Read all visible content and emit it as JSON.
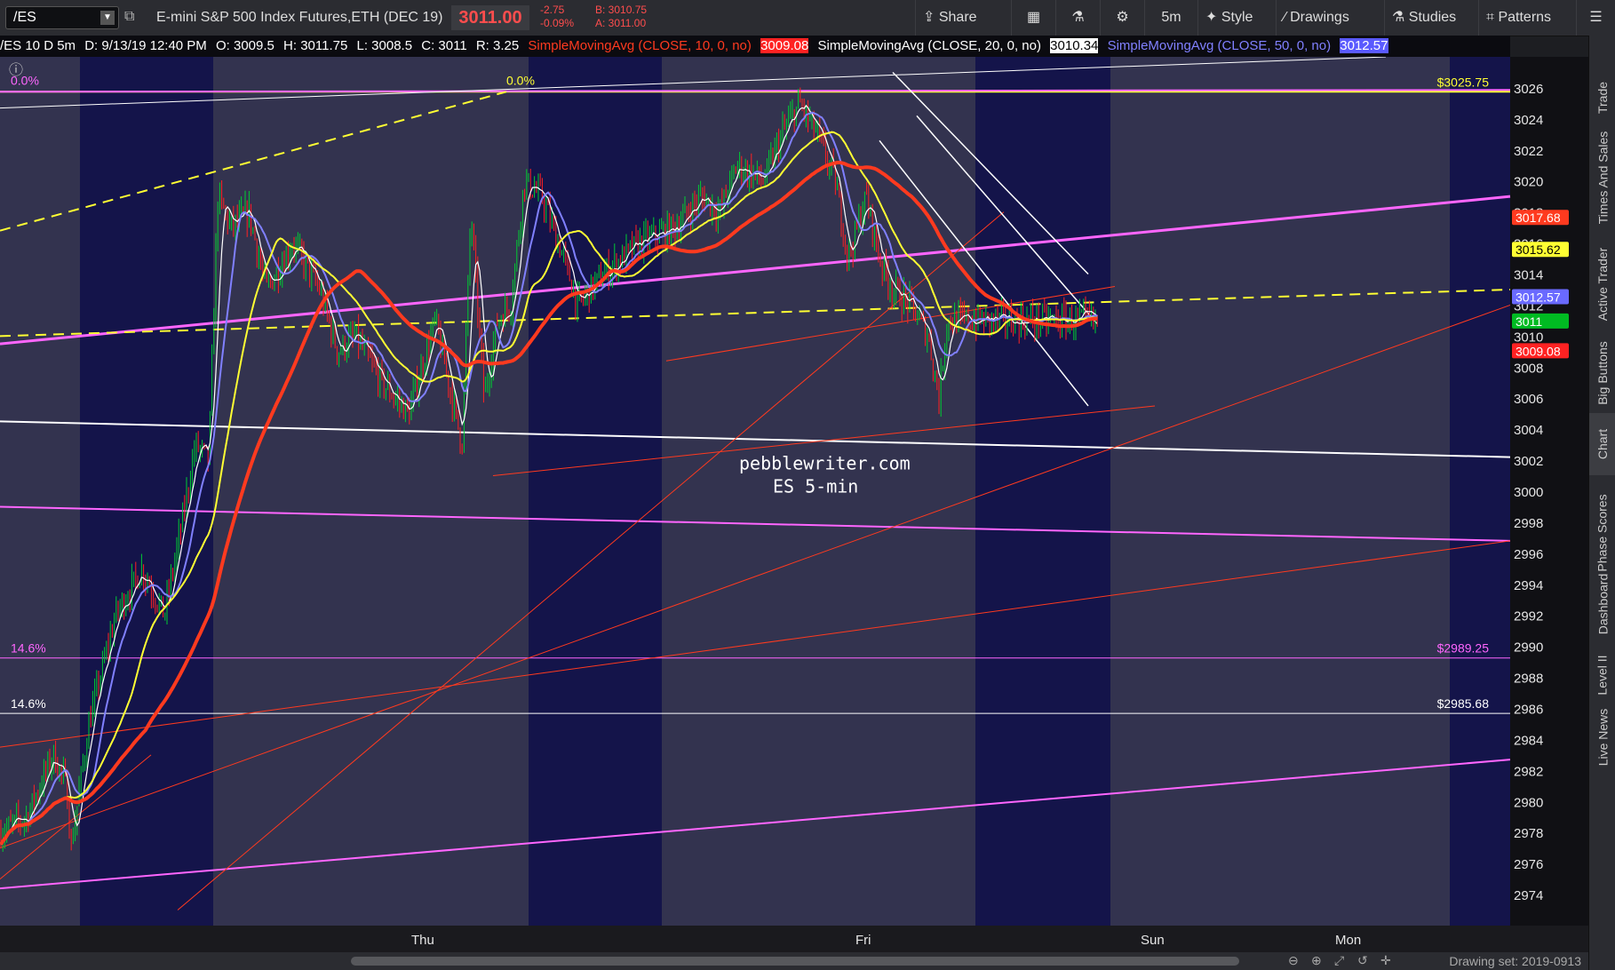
{
  "toolbar": {
    "symbol": "/ES",
    "description": "E-mini S&P 500 Index Futures,ETH (DEC 19)",
    "last_price": "3011.00",
    "change": "-2.75",
    "change_pct": "-0.09%",
    "bid": "B: 3010.75",
    "ask": "A: 3011.00",
    "share": "Share",
    "timeframe": "5m",
    "style": "Style",
    "drawings": "Drawings",
    "studies": "Studies",
    "patterns": "Patterns"
  },
  "infobar": {
    "symbol_info": "/ES 10 D 5m",
    "datetime": "D: 9/13/19 12:40 PM",
    "open": "O: 3009.5",
    "high": "H: 3011.75",
    "low": "L: 3008.5",
    "close": "C: 3011",
    "range": "R: 3.25",
    "sma10_label": "SimpleMovingAvg (CLOSE, 10, 0, no)",
    "sma10_value": "3009.08",
    "sma20_label": "SimpleMovingAvg (CLOSE, 20, 0, no)",
    "sma20_value": "3010.34",
    "sma50_label": "SimpleMovingAvg (CLOSE, 50, 0, no)",
    "sma50_value": "3012.57"
  },
  "side_tabs": [
    "Trade",
    "Times And Sales",
    "Active Trader",
    "Big Buttons",
    "Chart",
    "Phase Scores",
    "Dashboard",
    "Level II",
    "Live News"
  ],
  "bottom": {
    "drawing_set": "Drawing set: 2019-0913"
  },
  "colors": {
    "bg_session": "#14144a",
    "bg_offhours": "#33334f",
    "sma_red": "#ff3a1f",
    "sma_yellow": "#ffff33",
    "sma_blue": "#8080ff",
    "sma_white": "#ffffff",
    "magenta": "#ff66ff",
    "up": "#00cc33",
    "down": "#ff2222"
  },
  "chart_data": {
    "type": "candlestick",
    "ylim": [
      2972,
      3028
    ],
    "yticks": [
      2974,
      2976,
      2978,
      2980,
      2982,
      2984,
      2986,
      2988,
      2990,
      2992,
      2994,
      2996,
      2998,
      3000,
      3002,
      3004,
      3006,
      3008,
      3010,
      3012,
      3014,
      3016,
      3018,
      3020,
      3022,
      3024,
      3026
    ],
    "xticks": [
      "Thu",
      "Fri",
      "Sun",
      "Mon"
    ],
    "watermark": [
      "pebblewriter.com",
      "ES 5-min"
    ],
    "price_path": [
      [
        0,
        2978
      ],
      [
        30,
        2979
      ],
      [
        60,
        2983
      ],
      [
        75,
        2981
      ],
      [
        80,
        2977
      ],
      [
        100,
        2985
      ],
      [
        130,
        2992
      ],
      [
        160,
        2995
      ],
      [
        185,
        2992
      ],
      [
        205,
        2998
      ],
      [
        220,
        3003
      ],
      [
        235,
        3002
      ],
      [
        245,
        3019
      ],
      [
        260,
        3017
      ],
      [
        280,
        3018
      ],
      [
        300,
        3013
      ],
      [
        330,
        3016
      ],
      [
        360,
        3013
      ],
      [
        380,
        3009
      ],
      [
        400,
        3010
      ],
      [
        430,
        3007
      ],
      [
        460,
        3005
      ],
      [
        490,
        3011
      ],
      [
        520,
        3003
      ],
      [
        530,
        3018
      ],
      [
        545,
        3006
      ],
      [
        560,
        3011
      ],
      [
        575,
        3012
      ],
      [
        590,
        3020
      ],
      [
        610,
        3019
      ],
      [
        635,
        3015
      ],
      [
        650,
        3012
      ],
      [
        680,
        3014
      ],
      [
        720,
        3016
      ],
      [
        760,
        3017
      ],
      [
        790,
        3019
      ],
      [
        810,
        3018
      ],
      [
        830,
        3021
      ],
      [
        860,
        3020
      ],
      [
        880,
        3023
      ],
      [
        900,
        3025
      ],
      [
        920,
        3023
      ],
      [
        940,
        3020
      ],
      [
        955,
        3015
      ],
      [
        975,
        3019
      ],
      [
        990,
        3015
      ],
      [
        1005,
        3013
      ],
      [
        1025,
        3012
      ],
      [
        1045,
        3010
      ],
      [
        1057,
        3006
      ],
      [
        1066,
        3011
      ]
    ],
    "annotations": [
      {
        "text": "$3025.75",
        "price": 3025.75,
        "color": "#ffff33"
      },
      {
        "text": "$2989.25",
        "price": 2989.25,
        "color": "#ff66ff"
      },
      {
        "text": "$2985.68",
        "price": 2985.68,
        "color": "#ffffff"
      },
      {
        "text": "0.0%",
        "color": "#ff66ff"
      },
      {
        "text": "0.0%",
        "color": "#ffff33"
      },
      {
        "text": "14.6%",
        "color": "#ff66ff"
      },
      {
        "text": "14.6%",
        "color": "#ffffff"
      }
    ],
    "price_tags": [
      {
        "price": 3017.68,
        "text": "3017.68",
        "color": "#ff3a1f"
      },
      {
        "price": 3015.62,
        "text": "3015.62",
        "color": "#ffff33"
      },
      {
        "price": 3012.57,
        "text": "3012.57",
        "color": "#6a6aff"
      },
      {
        "price": 3011,
        "text": "3011",
        "color": "#00bb22"
      },
      {
        "price": 3009.08,
        "text": "3009.08",
        "color": "#ff2222"
      }
    ],
    "series": [
      {
        "name": "SimpleMovingAvg (CLOSE, 10, 0, no)",
        "color": "#ffffff"
      },
      {
        "name": "SimpleMovingAvg (CLOSE, 20, 0, no)",
        "color": "#8080ff"
      },
      {
        "name": "SimpleMovingAvg (CLOSE, 50, 0, no)",
        "color": "#ffff33"
      },
      {
        "color": "#ff3a1f"
      }
    ],
    "trendlines": [
      {
        "color": "#ff66ff",
        "price_left": 3009.5,
        "price_right": 3019
      },
      {
        "color": "#ffff33",
        "price_left": 3010,
        "price_right": 3013
      },
      {
        "color": "#ffffff",
        "price_left": 3004.5,
        "price_right": 3002.2
      },
      {
        "color": "#ff66ff",
        "price_left": 2999,
        "price_right": 2996.8
      },
      {
        "color": "#ff66ff",
        "price_left": 2974.4,
        "price_right": 2982.7
      }
    ]
  }
}
